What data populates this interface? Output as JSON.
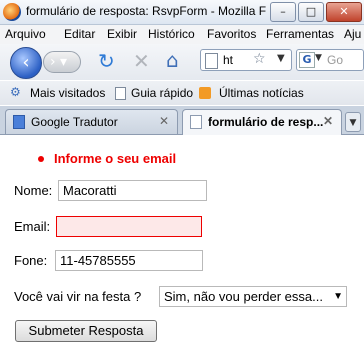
{
  "window": {
    "title": "formulário de resposta: RsvpForm - Mozilla Firefox"
  },
  "menu": {
    "items": [
      "Arquivo",
      "Editar",
      "Exibir",
      "Histórico",
      "Favoritos",
      "Ferramentas",
      "Aju"
    ]
  },
  "nav": {
    "url_text": "ht",
    "search_placeholder": "Go",
    "search_engine_letter": "G"
  },
  "bookmarks": {
    "items": [
      "Mais visitados",
      "Guia rápido",
      "Últimas notícias"
    ]
  },
  "tabs": [
    {
      "label": "Google Tradutor",
      "active": false
    },
    {
      "label": "formulário de resp...",
      "active": true
    }
  ],
  "form": {
    "error_message": "Informe o seu email",
    "nome_label": "Nome:",
    "nome_value": "Macoratti",
    "email_label": "Email:",
    "email_value": "",
    "fone_label": "Fone:",
    "fone_value": "11-45785555",
    "festa_label": "Você vai vir na festa ?",
    "festa_selected": "Sim, não vou perder essa....",
    "submit_label": "Submeter Resposta"
  },
  "colors": {
    "error": "#e00000",
    "invalid_field_bg": "#fde8e8"
  }
}
